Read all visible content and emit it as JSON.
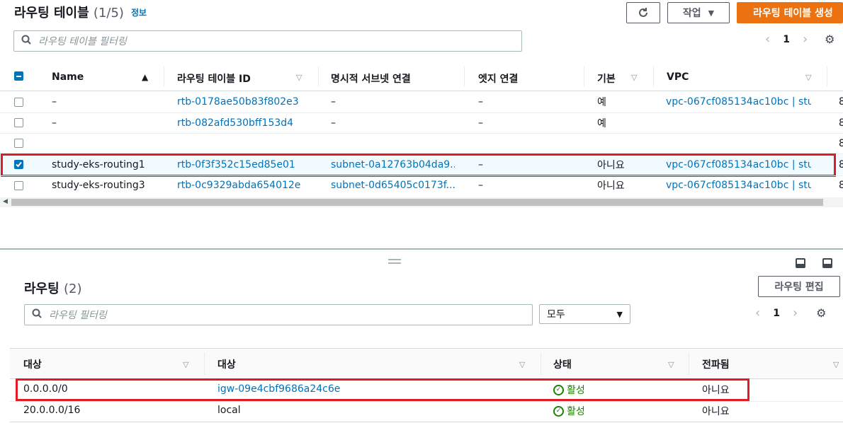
{
  "top": {
    "title": "라우팅 테이블",
    "count": "(1/5)",
    "info_link": "정보",
    "refresh_icon": "refresh-icon",
    "actions_label": "작업",
    "create_label": "라우팅 테이블 생성",
    "search_placeholder": "라우팅 테이블 필터링",
    "page": "1"
  },
  "table": {
    "headers": [
      "Name",
      "라우팅 테이블 ID",
      "명시적 서브넷 연결",
      "엣지 연결",
      "기본",
      "VPC"
    ],
    "rows": [
      {
        "name": "–",
        "id": "rtb-0178ae50b83f802e3",
        "subnet": "–",
        "edge": "–",
        "main": "예",
        "vpc": "vpc-067cf085134ac10bc | stu...",
        "extra": "8"
      },
      {
        "name": "–",
        "id": "rtb-082afd530bff153d4",
        "subnet": "–",
        "edge": "–",
        "main": "예",
        "vpc": "",
        "extra": "8"
      },
      {
        "name": "",
        "id": "",
        "subnet": "",
        "edge": "",
        "main": "",
        "vpc": "",
        "extra": "8"
      },
      {
        "name": "study-eks-routing1",
        "id": "rtb-0f3f352c15ed85e01",
        "subnet": "subnet-0a12763b04da9...",
        "edge": "–",
        "main": "아니요",
        "vpc": "vpc-067cf085134ac10bc | stu...",
        "extra": "8"
      },
      {
        "name": "study-eks-routing3",
        "id": "rtb-0c9329abda654012e",
        "subnet": "subnet-0d65405c0173f...",
        "edge": "–",
        "main": "아니요",
        "vpc": "vpc-067cf085134ac10bc | stu...",
        "extra": "8"
      }
    ]
  },
  "routes": {
    "title": "라우팅",
    "count": "(2)",
    "edit_label": "라우팅 편집",
    "search_placeholder": "라우팅 필터링",
    "filter_value": "모두",
    "page": "1",
    "headers": [
      "대상",
      "대상",
      "상태",
      "전파됨"
    ],
    "rows": [
      {
        "dest": "0.0.0.0/0",
        "target": "igw-09e4cbf9686a24c6e",
        "status": "활성",
        "propagated": "아니요"
      },
      {
        "dest": "20.0.0.0/16",
        "target": "local",
        "status": "활성",
        "propagated": "아니요"
      }
    ]
  },
  "colors": {
    "accent": "#0073bb",
    "primary": "#ec7211",
    "success": "#1d8102",
    "highlight": "#e01b24"
  }
}
